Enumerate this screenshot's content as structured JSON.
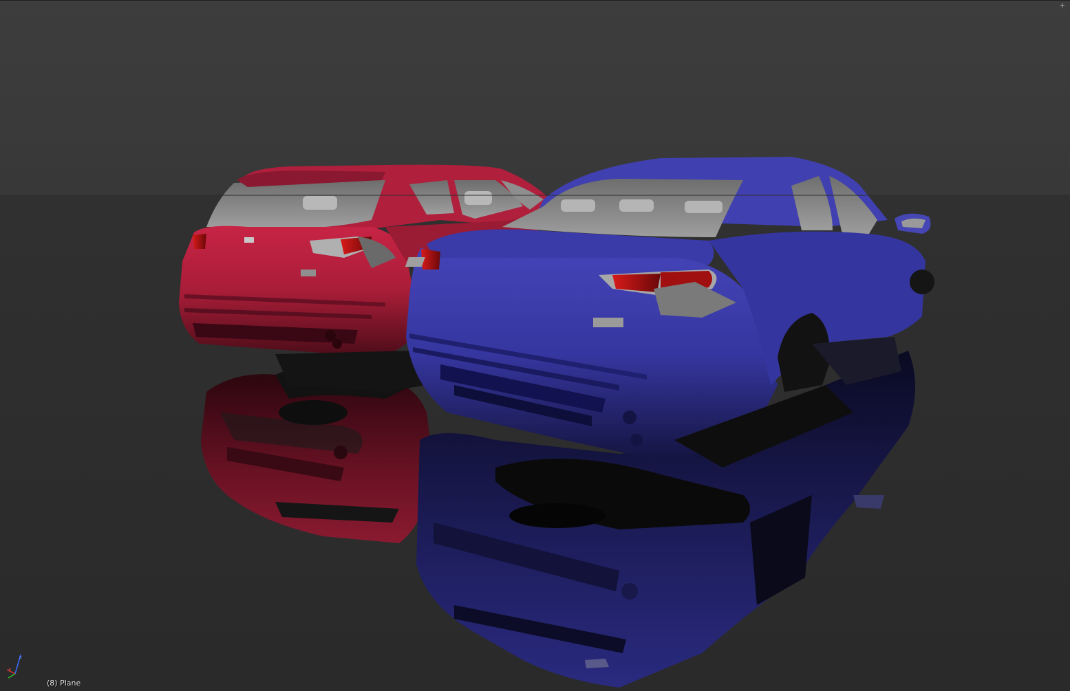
{
  "viewport": {
    "object_info": "(8) Plane",
    "corner_widget_glyph": "+"
  },
  "colors": {
    "sky": "#3a3a3a",
    "floor": "#2b2b2b",
    "red_car": "#b8203c",
    "blue_car": "#3a3aa8",
    "glass": "#9a9a9a",
    "taillight": "#c01010"
  },
  "icons": {
    "axis_gizmo": "axis-gizmo-icon",
    "corner": "viewport-split-icon"
  }
}
